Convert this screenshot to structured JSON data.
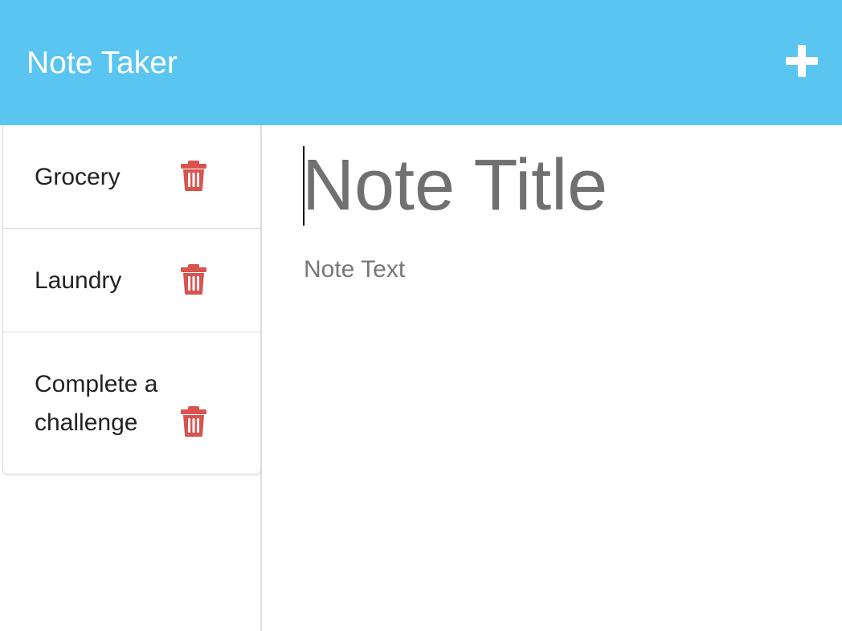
{
  "navbar": {
    "brand": "Note Taker",
    "new_note_icon": "plus-icon",
    "background": "#5bc5f1"
  },
  "notes": [
    {
      "title": "Grocery",
      "delete_icon": "trash-icon"
    },
    {
      "title": "Laundry",
      "delete_icon": "trash-icon"
    },
    {
      "title": "Complete a challenge",
      "delete_icon": "trash-icon"
    }
  ],
  "editor": {
    "title_placeholder": "Note Title",
    "text_placeholder": "Note Text"
  },
  "colors": {
    "delete": "#d9534f",
    "brand_text": "#ffffff"
  }
}
